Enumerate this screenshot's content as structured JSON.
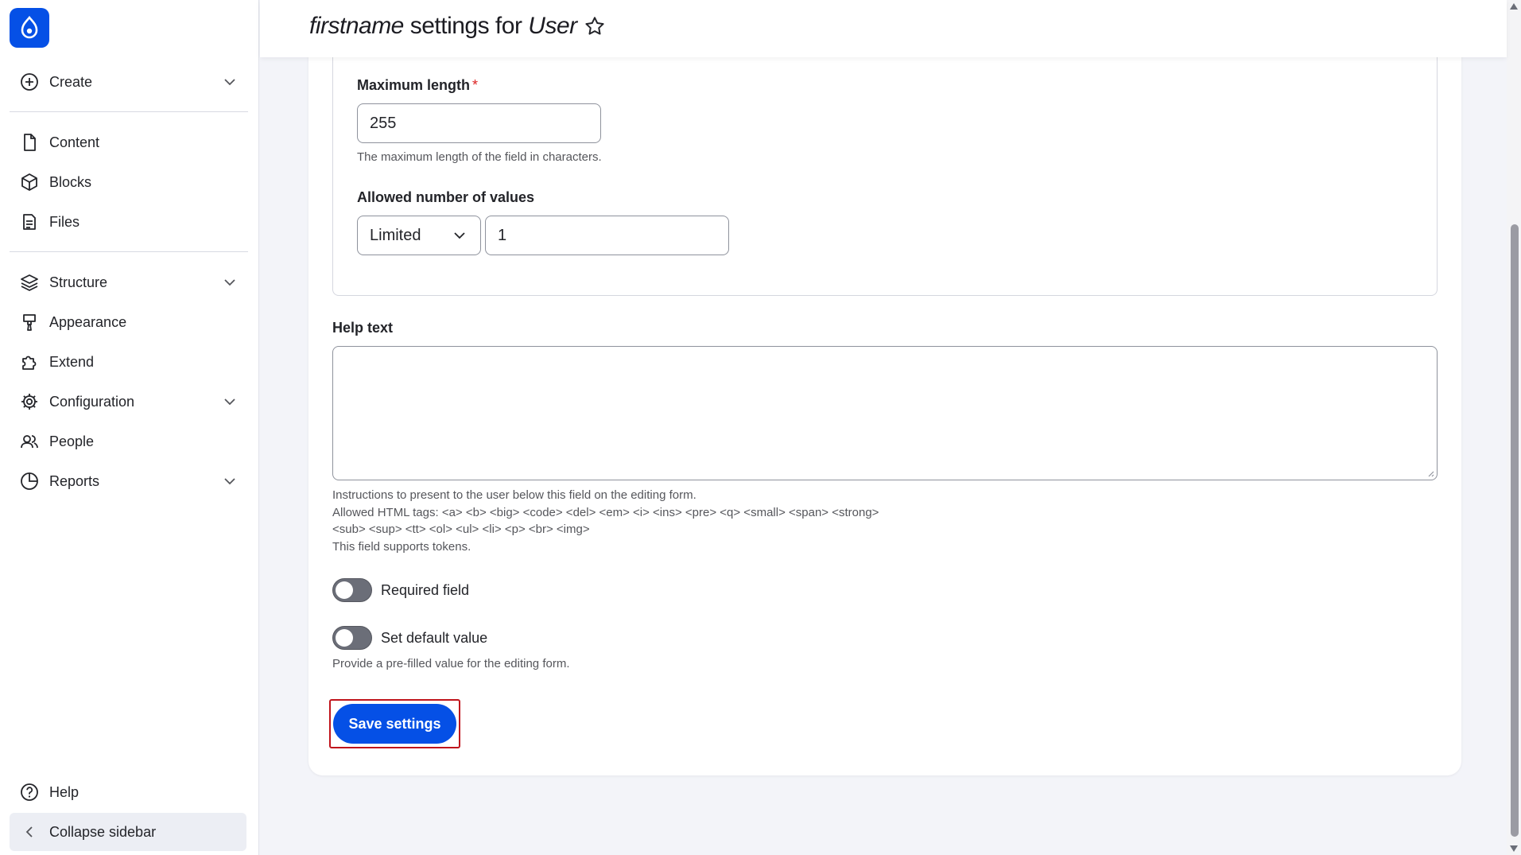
{
  "sidebar": {
    "items": [
      {
        "label": "Create",
        "icon": "plus-circle-icon"
      },
      {
        "label": "Content",
        "icon": "file-icon"
      },
      {
        "label": "Blocks",
        "icon": "cube-icon"
      },
      {
        "label": "Files",
        "icon": "document-icon"
      },
      {
        "label": "Structure",
        "icon": "layers-icon"
      },
      {
        "label": "Appearance",
        "icon": "brush-icon"
      },
      {
        "label": "Extend",
        "icon": "puzzle-icon"
      },
      {
        "label": "Configuration",
        "icon": "gear-icon"
      },
      {
        "label": "People",
        "icon": "people-icon"
      },
      {
        "label": "Reports",
        "icon": "pie-chart-icon"
      }
    ],
    "help_label": "Help",
    "collapse_label": "Collapse sidebar"
  },
  "header": {
    "title_field": "firstname",
    "title_mid": " settings for ",
    "title_entity": "User"
  },
  "form": {
    "max_length_label": "Maximum length",
    "max_length_required": "*",
    "max_length_value": "255",
    "max_length_desc": "The maximum length of the field in characters.",
    "allowed_values_label": "Allowed number of values",
    "allowed_values_select": "Limited",
    "allowed_values_count": "1",
    "help_text_label": "Help text",
    "help_text_value": "",
    "help_desc_1": "Instructions to present to the user below this field on the editing form.",
    "help_desc_2": "Allowed HTML tags: <a> <b> <big> <code> <del> <em> <i> <ins> <pre> <q> <small> <span> <strong>",
    "help_desc_3": "<sub> <sup> <tt> <ol> <ul> <li> <p> <br> <img>",
    "help_desc_4": "This field supports tokens.",
    "required_label": "Required field",
    "default_label": "Set default value",
    "default_desc": "Provide a pre-filled value for the editing form.",
    "save_label": "Save settings"
  },
  "colors": {
    "accent": "#0550e6",
    "highlight": "#c0141c"
  }
}
